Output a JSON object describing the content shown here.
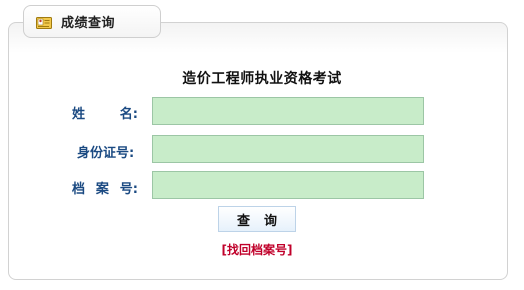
{
  "tab": {
    "title": "成绩查询",
    "icon": "id-card-icon"
  },
  "exam_title": "造价工程师执业资格考试",
  "fields": [
    {
      "label_chars": [
        "姓",
        "名:"
      ],
      "value": "",
      "placeholder": ""
    },
    {
      "label_chars": [
        "身份证号:"
      ],
      "value": "",
      "placeholder": ""
    },
    {
      "label_chars": [
        "档",
        "案",
        "号:"
      ],
      "value": "",
      "placeholder": ""
    }
  ],
  "buttons": {
    "query_label": "查询"
  },
  "links": {
    "retrieve_archive": "[找回档案号]"
  },
  "colors": {
    "label": "#1b4a82",
    "field_bg": "#c8ecc9",
    "link": "#c0002a"
  }
}
